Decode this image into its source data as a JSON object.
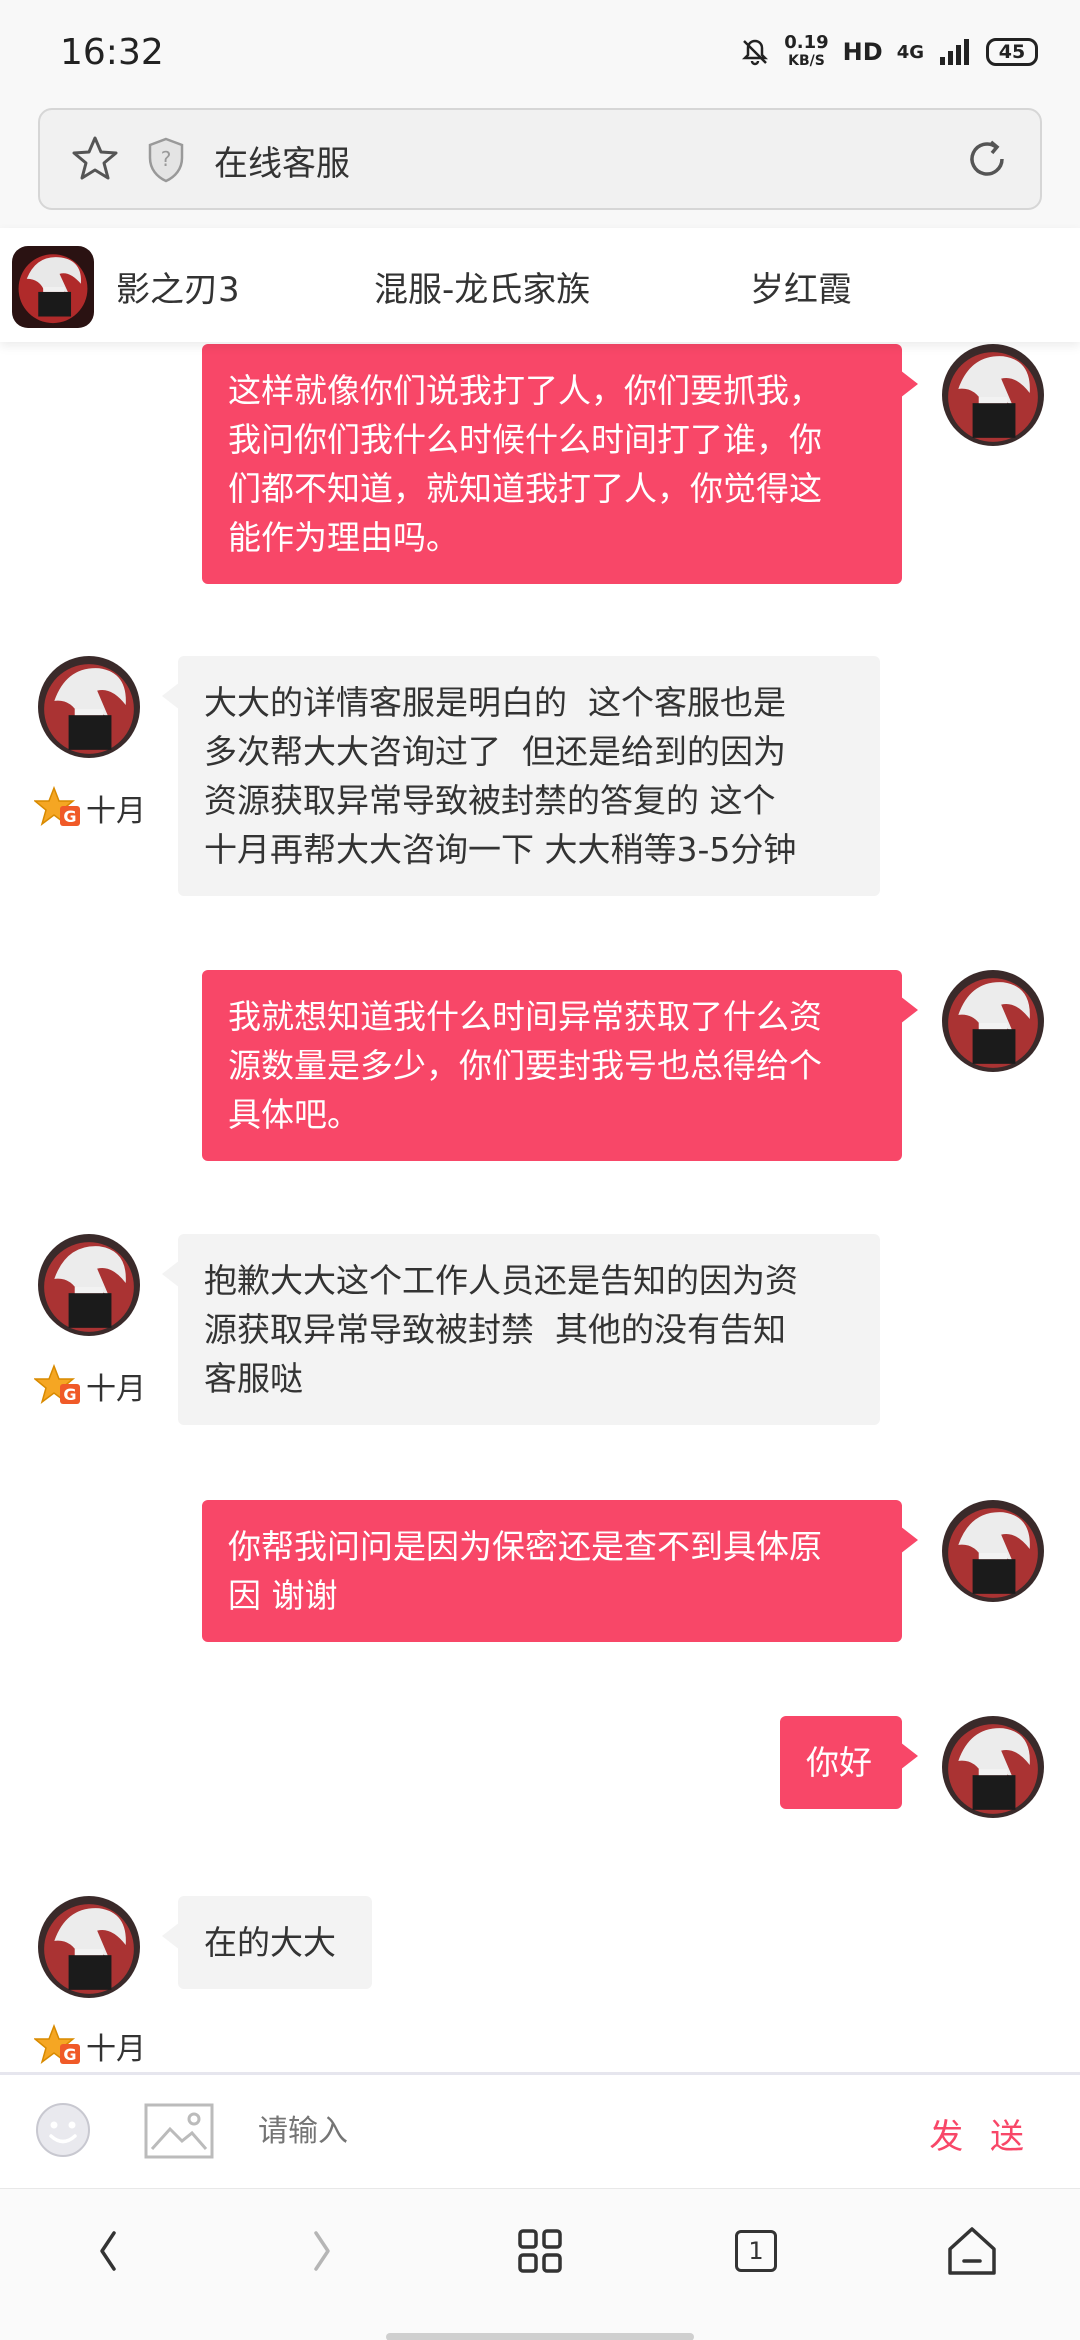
{
  "status_bar": {
    "time": "16:32",
    "speed_value": "0.19",
    "speed_unit": "KB/S",
    "hd": "HD",
    "network": "4G",
    "battery": "45"
  },
  "browser": {
    "page_title": "在线客服"
  },
  "chat_header": {
    "game": "影之刃3",
    "group": "混服-龙氏家族",
    "agent": "岁红霞"
  },
  "messages": [
    {
      "from": "user",
      "text": "这样就像你们说我打了人，你们要抓我，\n我问你们我什么时候什么时间打了谁，你\n们都不知道，就知道我打了人，你觉得这\n能作为理由吗。"
    },
    {
      "from": "agent",
      "sender": "十月",
      "text": "大大的详情客服是明白的  这个客服也是\n多次帮大大咨询过了  但还是给到的因为\n资源获取异常导致被封禁的答复的 这个\n十月再帮大大咨询一下 大大稍等3-5分钟"
    },
    {
      "from": "user",
      "text": "我就想知道我什么时间异常获取了什么资\n源数量是多少，你们要封我号也总得给个\n具体吧。"
    },
    {
      "from": "agent",
      "sender": "十月",
      "text": "抱歉大大这个工作人员还是告知的因为资\n源获取异常导致被封禁  其他的没有告知\n客服哒"
    },
    {
      "from": "user",
      "text": "你帮我问问是因为保密还是查不到具体原\n因 谢谢"
    },
    {
      "from": "user",
      "text": "你好"
    },
    {
      "from": "agent",
      "sender": "十月",
      "text": "在的大大"
    }
  ],
  "input_bar": {
    "placeholder": "请输入",
    "send_label": "发 送"
  },
  "bottom_nav": {
    "tabs_count": "1"
  },
  "colors": {
    "accent": "#f84768",
    "agent_bubble": "#f3f3f3"
  }
}
